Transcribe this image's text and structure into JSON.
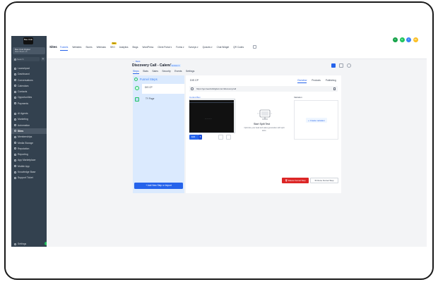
{
  "sidebar": {
    "logo_text": "Bee Club",
    "account": {
      "name": "Bee Club Digital",
      "sub": "Miami Beach, FL"
    },
    "search_placeholder": "Search",
    "search_shortcut": "",
    "items": [
      {
        "label": "Launchpad"
      },
      {
        "label": "Dashboard"
      },
      {
        "label": "Conversations"
      },
      {
        "label": "Calendars"
      },
      {
        "label": "Contacts"
      },
      {
        "label": "Opportunities"
      },
      {
        "label": "Payments"
      }
    ],
    "items2": [
      {
        "label": "AI Agents"
      },
      {
        "label": "Marketing"
      },
      {
        "label": "Automation"
      },
      {
        "label": "Sites"
      },
      {
        "label": "Memberships"
      },
      {
        "label": "Media Storage"
      },
      {
        "label": "Reputation"
      },
      {
        "label": "Reporting"
      },
      {
        "label": "App Marketplace"
      },
      {
        "label": "Mobile App"
      },
      {
        "label": "Knowledge Base"
      },
      {
        "label": "Support Ticket"
      }
    ],
    "settings_label": "Settings"
  },
  "topbar": {
    "module_title": "Sites",
    "tabs": [
      "Funnels",
      "Websites",
      "Stores",
      "Webinars",
      "Analytics",
      "Blogs",
      "WordPress",
      "Client Portal ▾",
      "Forms ▾",
      "Surveys ▾",
      "Quizzes ▾",
      "Chat Widget",
      "QR Codes"
    ],
    "new_badge": "New",
    "badge_inline": "SEO",
    "avatars": [
      {
        "text": "C",
        "color": "#16a34a"
      },
      {
        "text": "G",
        "color": "#22c55e"
      },
      {
        "text": "?",
        "color": "#3b82f6"
      },
      {
        "text": "JD",
        "color": "#fbbf24"
      }
    ]
  },
  "funnel": {
    "back_label": "← Back",
    "title": "Discovery Call - Calendar",
    "version_badge": "Version 2",
    "tabs": [
      "Steps",
      "Stats",
      "Sales",
      "Security",
      "Events",
      "Settings"
    ],
    "steps_title": "Funnel Steps",
    "steps": [
      {
        "name": "DIS CP"
      },
      {
        "name": "TY Page"
      }
    ],
    "add_step_label": "+ Add New Step or Import",
    "detail": {
      "step_name": "DIS CP",
      "tabs": [
        "Overview",
        "Products",
        "Publishing"
      ],
      "url": "https://go.beeclubdigital.com/discoverycall",
      "preview_label": "Control Box",
      "preview_text": "— — — —",
      "edit_label": "Edit",
      "split_title": "Start Split Test",
      "split_desc": "Optimize your lead and sales generation with split tests.",
      "variation_label": "Variation",
      "create_variation_label": "+ Create variation",
      "delete_label": "🗑 Delete Funnel Step",
      "clone_label": "⧉ Clone Funnel Step"
    }
  }
}
